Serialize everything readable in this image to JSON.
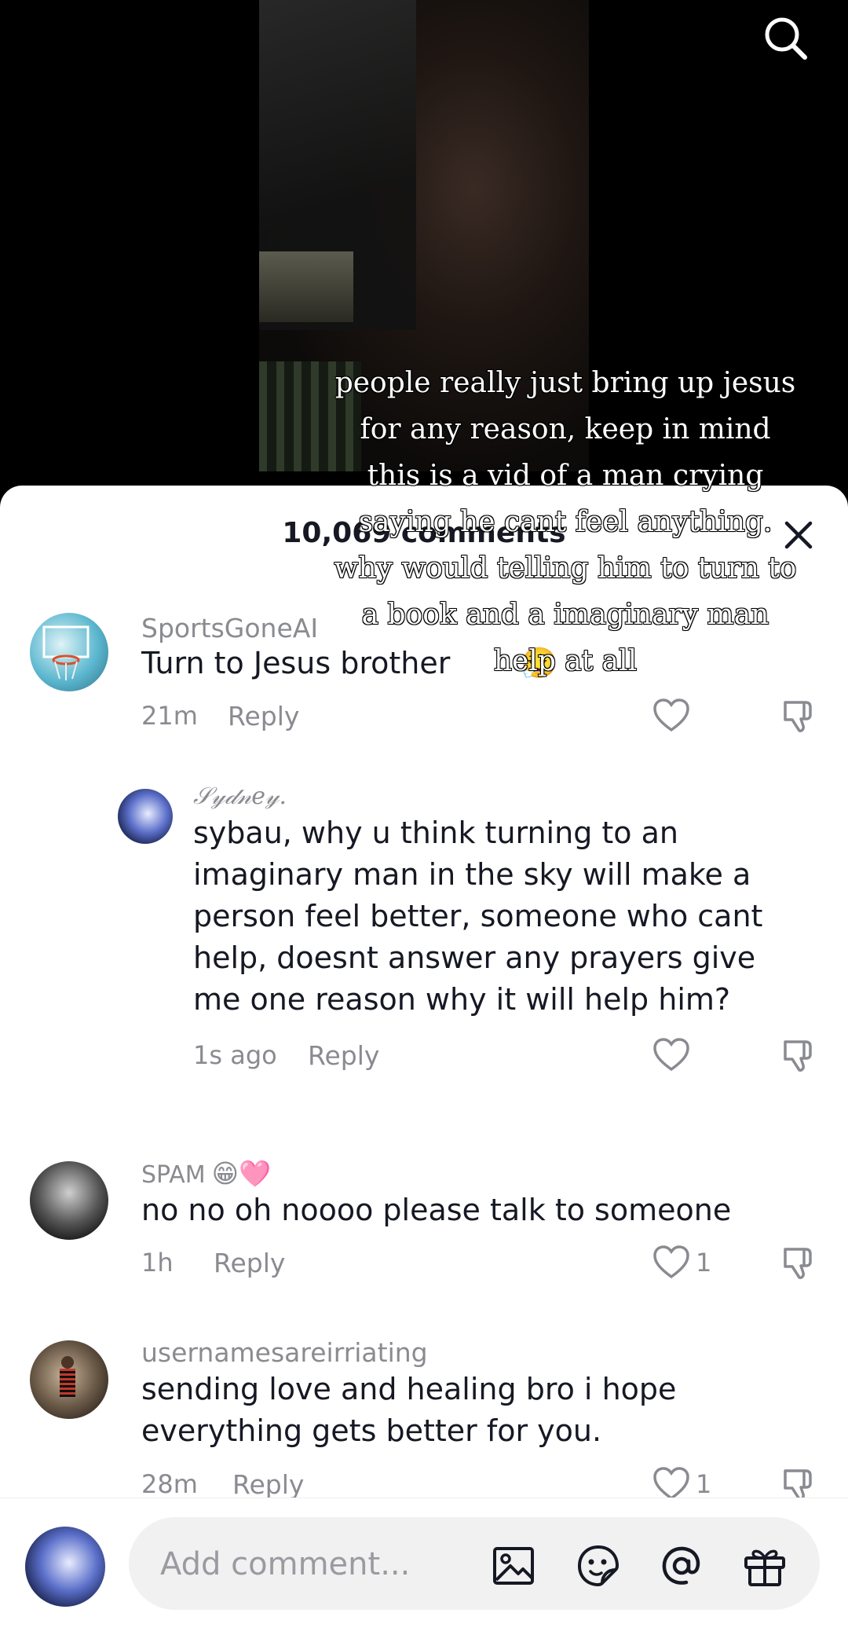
{
  "video": {
    "caption": "people really just bring up jesus for any reason, keep in mind this is a vid of a man crying saying he cant feel anything. why would telling him to turn to a book and a imaginary man help at all"
  },
  "header": {
    "comment_count": "10,069 comments"
  },
  "comments": [
    {
      "username": "SportsGoneAI",
      "text": "Turn to Jesus brother",
      "emoji": "😮‍💨",
      "time": "21m",
      "reply_label": "Reply",
      "likes": ""
    },
    {
      "username": "𝒮𝓎𝒹𝓃𝑒𝓎.",
      "text": "sybau, why u think turning to an imaginary man in the sky will make a person feel better, someone who cant help, doesnt answer any prayers give me one reason why it will help him?",
      "time": "1s ago",
      "reply_label": "Reply",
      "likes": ""
    },
    {
      "username": "SPAM",
      "username_emoji": "😁🩷",
      "text": "no no oh noooo please talk to someone",
      "time": "1h",
      "reply_label": "Reply",
      "likes": "1"
    },
    {
      "username": "usernamesareirriating",
      "text": "sending love and healing bro i hope everything gets better for you.",
      "time": "28m",
      "reply_label": "Reply",
      "likes": "1"
    }
  ],
  "comment_bar": {
    "placeholder": "Add comment...",
    "icons": [
      "image-icon",
      "sticker-icon",
      "mention-icon",
      "gift-icon"
    ]
  },
  "colors": {
    "text_primary": "#161823",
    "text_secondary": "#8a8b91",
    "pill_bg": "#f1f1f2"
  }
}
